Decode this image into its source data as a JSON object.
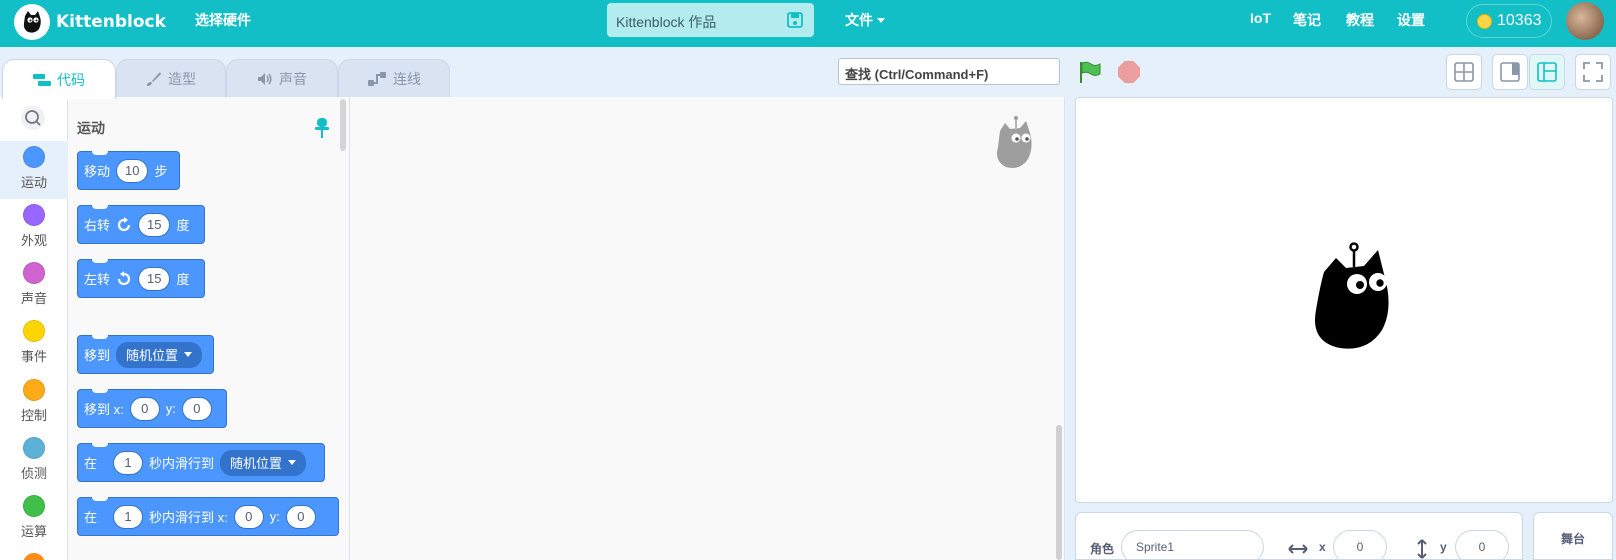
{
  "app": {
    "name": "Kittenblock",
    "hardware_label": "选择硬件",
    "project_name": "Kittenblock 作品",
    "file_menu": "文件"
  },
  "nav": {
    "iot": "IoT",
    "notes": "笔记",
    "tutorial": "教程",
    "settings": "设置",
    "coins": "10363"
  },
  "tabs": [
    {
      "label": "代码",
      "icon": "code-icon"
    },
    {
      "label": "造型",
      "icon": "brush-icon"
    },
    {
      "label": "声音",
      "icon": "speaker-icon"
    },
    {
      "label": "连线",
      "icon": "connect-icon"
    }
  ],
  "search": {
    "value": "查找 (Ctrl/Command+F)"
  },
  "categories": [
    {
      "label": "运动",
      "color": "#4c97ff"
    },
    {
      "label": "外观",
      "color": "#9966ff"
    },
    {
      "label": "声音",
      "color": "#cf63cf"
    },
    {
      "label": "事件",
      "color": "#ffd500"
    },
    {
      "label": "控制",
      "color": "#ffab19"
    },
    {
      "label": "侦测",
      "color": "#5cb1d6"
    },
    {
      "label": "运算",
      "color": "#40bf4a"
    }
  ],
  "palette": {
    "title": "运动",
    "blocks": {
      "move": {
        "a": "移动",
        "v": "10",
        "b": "步"
      },
      "turn_right": {
        "a": "右转",
        "v": "15",
        "b": "度"
      },
      "turn_left": {
        "a": "左转",
        "v": "15",
        "b": "度"
      },
      "goto": {
        "a": "移到",
        "dd": "随机位置"
      },
      "goto_xy": {
        "a": "移到 x:",
        "x": "0",
        "ylab": "y:",
        "y": "0"
      },
      "glide": {
        "a": "在",
        "v": "1",
        "b": "秒内滑行到",
        "dd": "随机位置"
      },
      "glide_xy": {
        "a": "在",
        "v": "1",
        "b": "秒内滑行到 x:",
        "x": "0",
        "ylab": "y:",
        "y": "0"
      }
    }
  },
  "sprite_info": {
    "sprite_label": "角色",
    "sprite_name": "Sprite1",
    "x_label": "x",
    "x": "0",
    "y_label": "y",
    "y": "0",
    "stage_label": "舞台"
  },
  "colors": {
    "accent": "#13bfc6",
    "motion": "#4c97ff"
  }
}
